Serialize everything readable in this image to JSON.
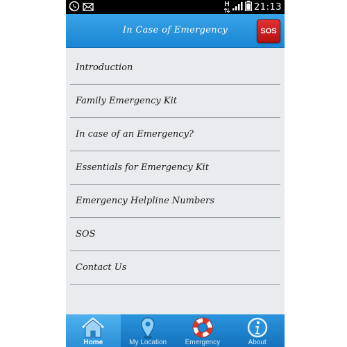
{
  "status_bar": {
    "time": "21:13",
    "network_type": "H",
    "icons": [
      "whatsapp-icon",
      "mail-icon",
      "network-h-icon",
      "signal-icon",
      "battery-icon"
    ]
  },
  "header": {
    "title": "In Case of Emergency",
    "sos_label": "SOS"
  },
  "menu": {
    "items": [
      {
        "label": "Introduction"
      },
      {
        "label": "Family Emergency Kit"
      },
      {
        "label": "In case of an Emergency?"
      },
      {
        "label": "Essentials for Emergency Kit"
      },
      {
        "label": "Emergency Helpline Numbers"
      },
      {
        "label": "SOS"
      },
      {
        "label": "Contact Us"
      }
    ]
  },
  "bottom_nav": {
    "tabs": [
      {
        "label": "Home",
        "icon": "home-icon",
        "active": true
      },
      {
        "label": "My Location",
        "icon": "location-pin-icon",
        "active": false
      },
      {
        "label": "Emergency",
        "icon": "lifebuoy-icon",
        "active": false
      },
      {
        "label": "About",
        "icon": "info-icon",
        "active": false
      }
    ]
  },
  "colors": {
    "action_bar": "#1a86d4",
    "sos_button": "#c71c1c",
    "list_background": "#e8ecee",
    "divider": "#8c959b",
    "bottom_nav": "#1572bd"
  }
}
